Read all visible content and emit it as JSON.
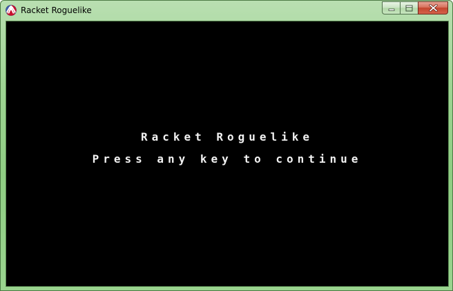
{
  "window": {
    "title": "Racket Roguelike",
    "app_icon": "racket-logo-icon",
    "buttons": {
      "minimize_icon": "minimize-icon",
      "maximize_icon": "maximize-icon",
      "close_icon": "close-icon"
    }
  },
  "game": {
    "background_color": "#000000",
    "text_color": "#f2f2f2",
    "title_line": "Racket Roguelike",
    "prompt_line": "Press any key to continue"
  }
}
